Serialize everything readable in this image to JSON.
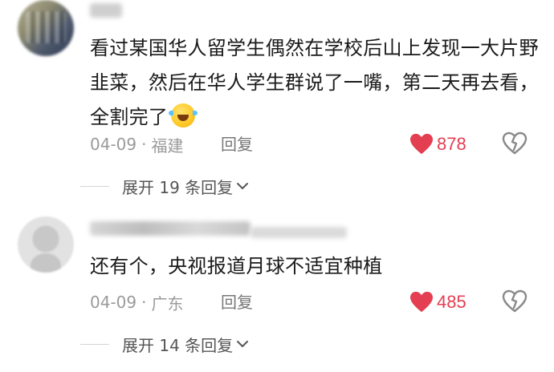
{
  "comments": [
    {
      "text": "看过某国华人留学生偶然在学校后山上发现一大片野韭菜，然后在华人学生群说了一嘴，第二天再去看，全割完了",
      "emoji": "laughing-crying-emoji",
      "date": "04-09",
      "separator": "·",
      "location": "福建",
      "reply_label": "回复",
      "likes": "878",
      "expand_label": "展开 19 条回复"
    },
    {
      "text": "还有个，央视报道月球不适宜种植",
      "date": "04-09",
      "separator": "·",
      "location": "广东",
      "reply_label": "回复",
      "likes": "485",
      "expand_label": "展开 14 条回复"
    }
  ],
  "colors": {
    "like_red": "#e33e52",
    "meta_gray": "#9a9a9a",
    "text_dark": "#1a1a1a"
  },
  "icons": [
    "heart-icon",
    "dislike-heart-icon",
    "chevron-down-icon",
    "avatar"
  ]
}
